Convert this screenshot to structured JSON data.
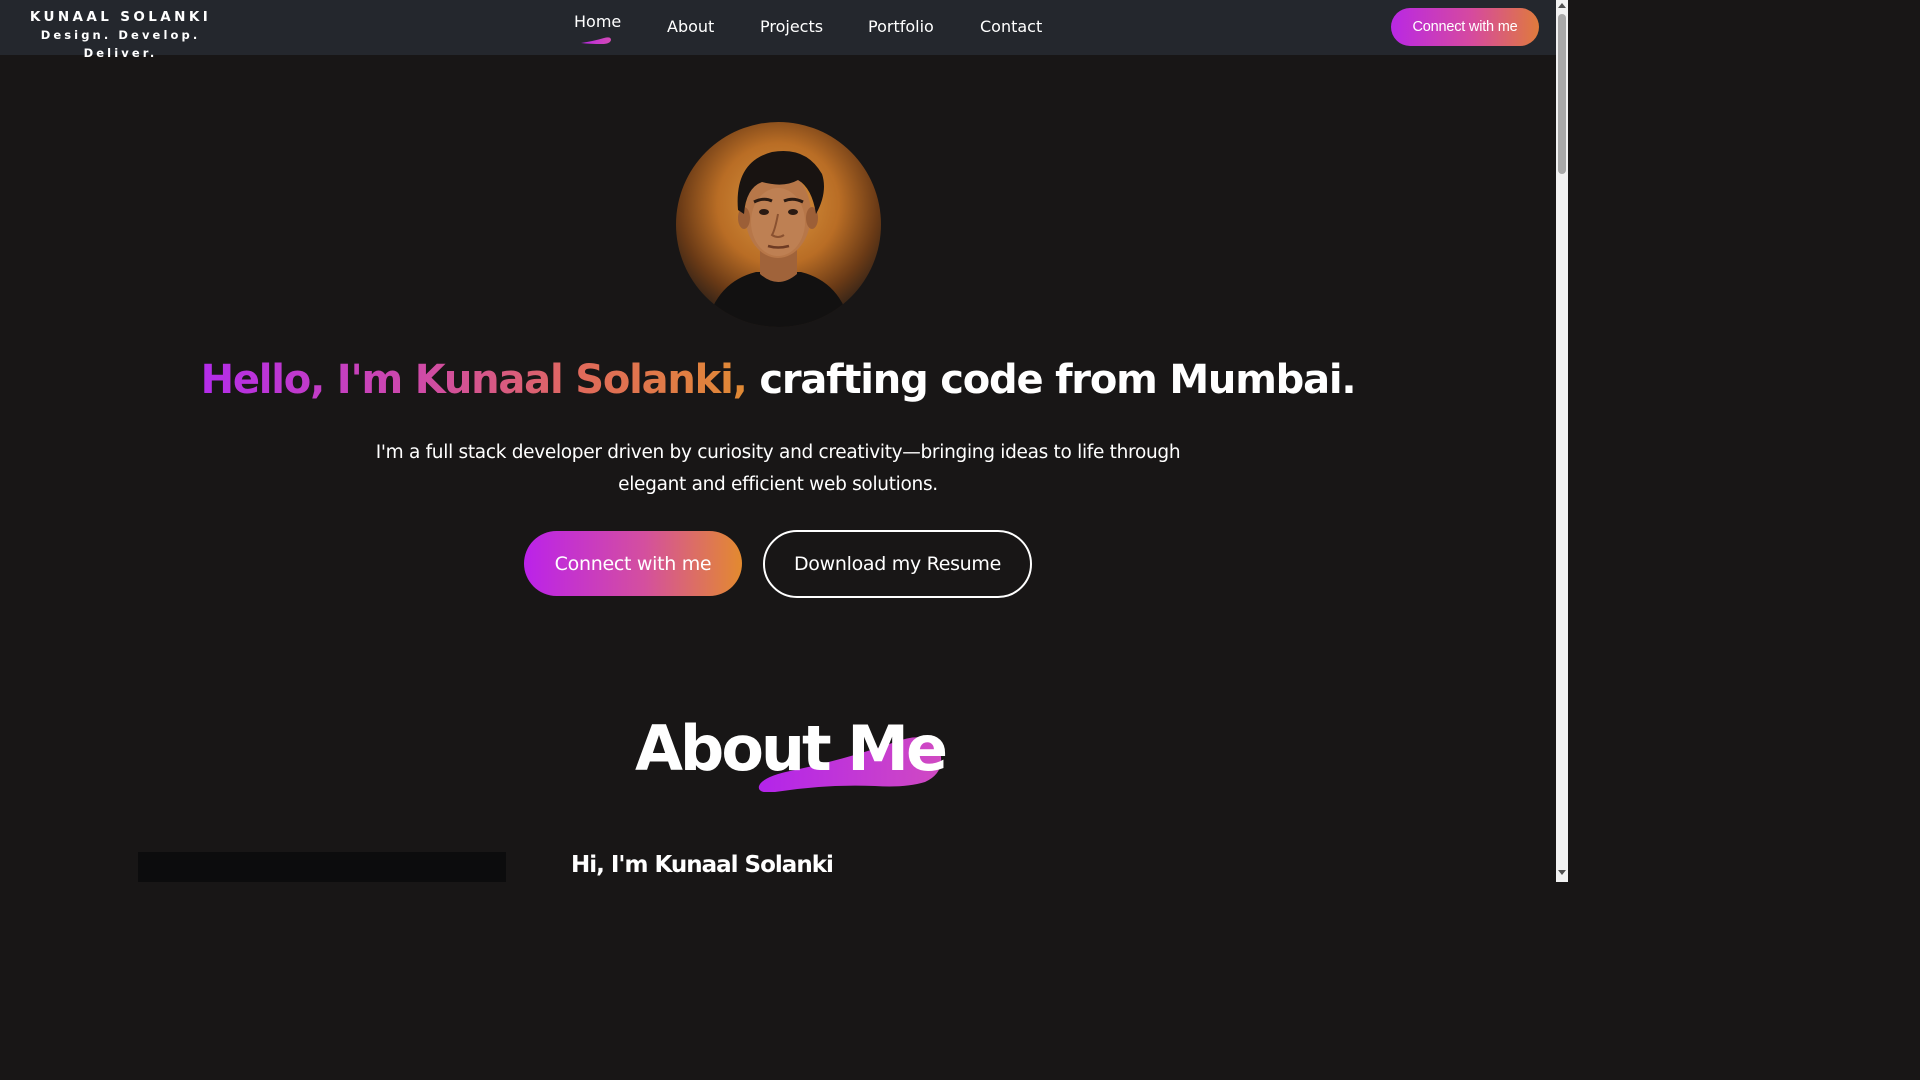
{
  "brand": {
    "name": "KUNAAL SOLANKI",
    "tagline": "Design. Develop. Deliver."
  },
  "nav": {
    "items": [
      {
        "label": "Home",
        "active": true
      },
      {
        "label": "About"
      },
      {
        "label": "Projects"
      },
      {
        "label": "Portfolio"
      },
      {
        "label": "Contact"
      }
    ],
    "cta_label": "Connect with me"
  },
  "hero": {
    "avatar_icon": "profile-photo",
    "title_highlight": "Hello, I'm Kunaal Solanki,",
    "title_rest": "crafting code from Mumbai.",
    "description": "I'm a full stack developer driven by curiosity and creativity—bringing ideas to life through elegant and efficient web solutions.",
    "primary_button": "Connect with me",
    "secondary_button": "Download my Resume"
  },
  "about": {
    "title": "About Me",
    "subtitle": "Hi, I'm Kunaal Solanki"
  },
  "colors": {
    "background": "#181616",
    "navbar": "#24272d",
    "accent_purple": "#b928e4",
    "accent_pink": "#d44f9f",
    "accent_orange": "#e38a2f"
  }
}
